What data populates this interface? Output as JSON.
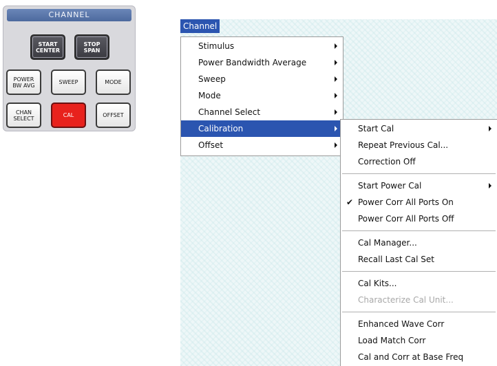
{
  "panel": {
    "title": "CHANNEL",
    "buttons": {
      "start_center": "START\nCENTER",
      "stop_span": "STOP\nSPAN",
      "power_bw_avg": "POWER\nBW AVG",
      "sweep": "SWEEP",
      "mode": "MODE",
      "chan_select": "CHAN\nSELECT",
      "cal": "CAL",
      "offset": "OFFSET"
    }
  },
  "menubar": {
    "channel": "Channel"
  },
  "channel_menu": {
    "items": [
      {
        "label": "Stimulus"
      },
      {
        "label": "Power Bandwidth Average"
      },
      {
        "label": "Sweep"
      },
      {
        "label": "Mode"
      },
      {
        "label": "Channel Select"
      },
      {
        "label": "Calibration"
      },
      {
        "label": "Offset"
      }
    ]
  },
  "calibration_menu": {
    "items": [
      {
        "label": "Start Cal"
      },
      {
        "label": "Repeat Previous Cal..."
      },
      {
        "label": "Correction Off"
      },
      {
        "label": "Start Power Cal"
      },
      {
        "label": "Power Corr All Ports On",
        "checked": true,
        "check": "✔"
      },
      {
        "label": "Power Corr All Ports Off"
      },
      {
        "label": "Cal Manager..."
      },
      {
        "label": "Recall Last Cal Set"
      },
      {
        "label": "Cal Kits..."
      },
      {
        "label": "Characterize Cal Unit...",
        "disabled": true
      },
      {
        "label": "Enhanced Wave Corr"
      },
      {
        "label": "Load Match Corr"
      },
      {
        "label": "Cal and Corr at Base Freq"
      }
    ]
  },
  "colors": {
    "menu_highlight": "#2b55b0",
    "cal_button_red": "#e8221d",
    "panel_title": "#4d6a9e"
  }
}
